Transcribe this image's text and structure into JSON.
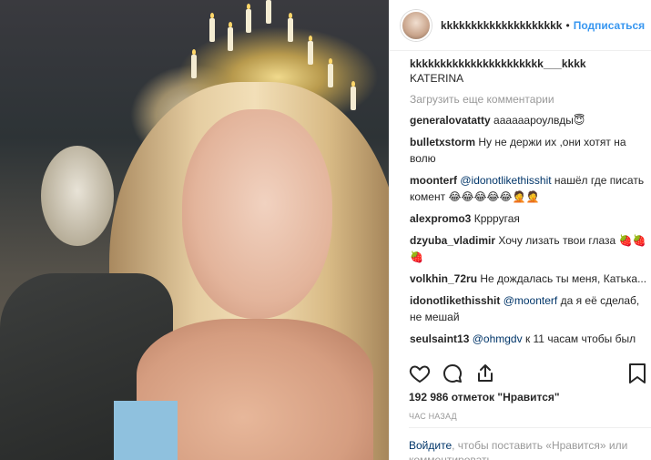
{
  "header": {
    "username": "kkkkkkkkkkkkkkkkkkkk",
    "dot": "•",
    "follow_label": "Подписаться"
  },
  "caption": {
    "username": "kkkkkkkkkkkkkkkkkkkkkk___kkkk",
    "text": "KATERINA"
  },
  "load_more_label": "Загрузить еще комментарии",
  "comments": [
    {
      "user": "generalovatatty",
      "text": "аааааароулвды😇"
    },
    {
      "user": "bulletxstorm",
      "text": "Ну не держи их ,они хотят на волю"
    },
    {
      "user": "moonterf",
      "mention": "@idonotlikethisshit",
      "text": "нашёл где писать комент 😂😂😂😂😂🤦🤦"
    },
    {
      "user": "alexpromo3",
      "text": "Кррругая"
    },
    {
      "user": "dzyuba_vladimir",
      "text": "Хочу лизать твои глаза 🍓🍓🍓"
    },
    {
      "user": "volkhin_72ru",
      "text": "Не дождалась ты меня, Катька..."
    },
    {
      "user": "idonotlikethisshit",
      "mention": "@moonterf",
      "text": "да я её сделаб, не мешай"
    },
    {
      "user": "seulsaint13",
      "mention": "@ohmgdv",
      "text": "к 11 часам чтобы был"
    }
  ],
  "likes_text": "192 986 отметок \"Нравится\"",
  "time_text": "час назад",
  "footer": {
    "login": "Войдите",
    "rest": ", чтобы поставить «Нравится» или комментировать"
  },
  "icons": {
    "heart": "heart-icon",
    "comment": "comment-icon",
    "share": "share-icon",
    "bookmark": "bookmark-icon"
  }
}
